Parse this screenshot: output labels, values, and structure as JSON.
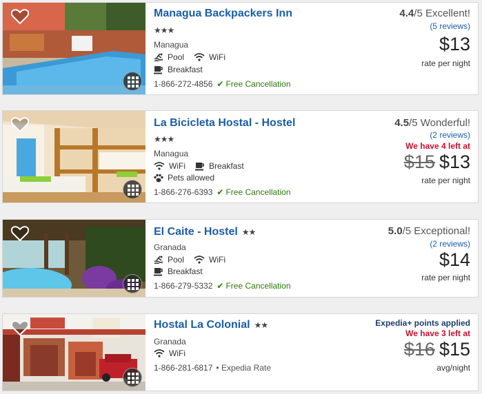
{
  "listings": [
    {
      "name": "Managua Backpackers Inn",
      "stars": "★★★",
      "city": "Managua",
      "amenities": [
        "Pool",
        "WiFi",
        "Breakfast"
      ],
      "phone": "1-866-272-4856",
      "policy": "Free Cancellation",
      "score": "4.4",
      "score_suffix": "/5 Excellent!",
      "reviews": "(5 reviews)",
      "price": "$13",
      "per": "rate per night"
    },
    {
      "name": "La Bicicleta Hostal - Hostel",
      "stars": "★★★",
      "city": "Managua",
      "amenities": [
        "WiFi",
        "Breakfast",
        "Pets allowed"
      ],
      "phone": "1-866-276-6393",
      "policy": "Free Cancellation",
      "score": "4.5",
      "score_suffix": "/5 Wonderful!",
      "reviews": "(2 reviews)",
      "availability": "We have 4 left at",
      "old_price": "$15",
      "price": "$13",
      "per": "rate per night"
    },
    {
      "name": "El Caite - Hostel",
      "stars": "★★",
      "city": "Granada",
      "amenities": [
        "Pool",
        "WiFi",
        "Breakfast"
      ],
      "phone": "1-866-279-5332",
      "policy": "Free Cancellation",
      "score": "5.0",
      "score_suffix": "/5 Exceptional!",
      "reviews": "(2 reviews)",
      "price": "$14",
      "per": "rate per night"
    },
    {
      "name": "Hostal La Colonial",
      "stars": "★★",
      "city": "Granada",
      "amenities": [
        "WiFi"
      ],
      "phone": "1-866-281-6817",
      "policy": "• Expedia Rate",
      "promo": "Expedia+ points applied",
      "availability": "We have 3 left at",
      "old_price": "$16",
      "price": "$15",
      "per": "avg/night"
    }
  ],
  "colors": {
    "link": "#1b5da8",
    "free": "#2b7a0b",
    "alert": "#c8102e"
  }
}
